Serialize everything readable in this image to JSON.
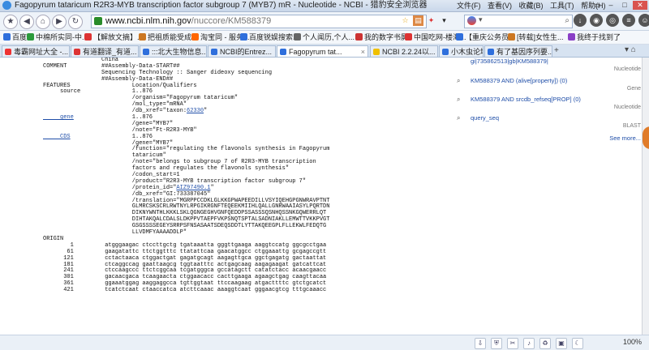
{
  "window": {
    "title": "Fagopyrum tataricum R2R3-MYB transcription factor subgroup 7 (MYB7) mR - Nucleotide - NCBI - 猎豹安全浏览器",
    "menu": [
      "文件(F)",
      "查看(V)",
      "收藏(B)",
      "工具(T)",
      "帮助(H)"
    ]
  },
  "navbar": {
    "url_host": "www.ncbi.nlm.nih.gov",
    "url_path": "/nuccore/KM588379",
    "search_placeholder": "",
    "search_engine": "g"
  },
  "bookmarks": [
    {
      "label": "百度",
      "color": "#2f6fdc"
    },
    {
      "label": "中棉所实同-中...",
      "color": "#2b9a3b"
    },
    {
      "label": "【解放文摘】...",
      "color": "#d33"
    },
    {
      "label": "把祖质能受成...",
      "color": "#c72"
    },
    {
      "label": "淘宝同 - 服务...",
      "color": "#f60"
    },
    {
      "label": "百度锐娱搜索...",
      "color": "#2f6fdc"
    },
    {
      "label": "个人闻历,个人...",
      "color": "#666"
    },
    {
      "label": "我的数字书屏",
      "color": "#c33"
    },
    {
      "label": "中国吃网-楼海...",
      "color": "#d33"
    },
    {
      "label": "【重庆公务员...",
      "color": "#2f6fdc"
    },
    {
      "label": "[转载]女性生...",
      "color": "#c72"
    },
    {
      "label": "我终于找到了",
      "color": "#8a3fc6"
    }
  ],
  "tabs": [
    {
      "label": "毒霸网址大全 -...",
      "active": false,
      "color": "#e33"
    },
    {
      "label": "有道翻译_有道...",
      "color": "#d33",
      "active": false
    },
    {
      "label": ":::北大生物信息...",
      "color": "#2f6fdc",
      "active": false
    },
    {
      "label": "NCBI的Entrez...",
      "color": "#2f6fdc",
      "active": false
    },
    {
      "label": "Fagopyrum tat...",
      "color": "#2f6fdc",
      "active": true
    },
    {
      "label": "NCBI 2.2.24以...",
      "color": "#f0c000",
      "active": false
    },
    {
      "label": "小木虫论坛 - 学...",
      "color": "#2f6fdc",
      "active": false
    },
    {
      "label": "有了基因序列要...",
      "color": "#2f6fdc",
      "active": false
    }
  ],
  "record": {
    "lines": [
      {
        "k": "",
        "v": "China"
      },
      {
        "k": "COMMENT",
        "v": "##Assembly-Data-START##"
      },
      {
        "k": "",
        "v": "Sequencing Technology :: Sanger dideoxy sequencing"
      },
      {
        "k": "",
        "v": "##Assembly-Data-END##"
      },
      {
        "k": "FEATURES",
        "v": "         Location/Qualifiers"
      },
      {
        "k": "     source",
        "v": "         1..876"
      },
      {
        "k": "",
        "v": "         /organism=\"Fagopyrum tataricum\""
      },
      {
        "k": "",
        "v": "         /mol_type=\"mRNA\""
      },
      {
        "k": "",
        "v": "         /db_xref=\"taxon:",
        "link": "62330",
        "tail": "\""
      },
      {
        "k": "     gene",
        "klink": true,
        "v": "         1..876"
      },
      {
        "k": "",
        "v": "         /gene=\"MYB7\""
      },
      {
        "k": "",
        "v": "         /note=\"Ft-R2R3-MYB\""
      },
      {
        "k": "     CDS",
        "klink": true,
        "v": "         1..876"
      },
      {
        "k": "",
        "v": "         /gene=\"MYB7\""
      },
      {
        "k": "",
        "v": "         /function=\"regulating the flavonols synthesis in Fagopyrum"
      },
      {
        "k": "",
        "v": "         tataricum\""
      },
      {
        "k": "",
        "v": "         /note=\"belongs to subgroup 7 of R2R3-MYB transcription"
      },
      {
        "k": "",
        "v": "         factors and regulates the flavonols synthesis\""
      },
      {
        "k": "",
        "v": "         /codon_start=1"
      },
      {
        "k": "",
        "v": "         /product=\"R2R3-MYB transcription factor subgroup 7\""
      },
      {
        "k": "",
        "v": "         /protein_id=\"",
        "link": "AIZ97490.1",
        "tail": "\""
      },
      {
        "k": "",
        "v": "         /db_xref=\"GI:733387045\""
      },
      {
        "k": "",
        "v": "         /translation=\"MGRPPCCDKLGLKKGPWAPEEDILLVSYIQEHGPGNWRAVPTNT"
      },
      {
        "k": "",
        "v": "         GLMRCSKSCRLRWTNYLRPGIKRGNFTEQEEKMIIHLQALLGNRWAAIASYLPQRTDN"
      },
      {
        "k": "",
        "v": "         DIKNYWNTHLKKKLSKLQGNGEGHVGNFQEDDPSSASSSQSNHQSSNKGQWERRLQT"
      },
      {
        "k": "",
        "v": "         DIHTAKQALCDALSLDKPPVTAEPFVKPSNQTSPTALSADNIAKLLEMWTTVKKPVGT"
      },
      {
        "k": "",
        "v": "         GSGSSSSEGEYSRRPSFNSASAATSDEQSDDTLYTTAKQEEGPLFLLEKWLFEDQTG"
      },
      {
        "k": "",
        "v": "         LLVDMFYAAAADDLP\""
      },
      {
        "k": "ORIGIN",
        "v": ""
      },
      {
        "k": "        1",
        "v": " atgggaagac ctccttgctg tgataaatta gggttgaaga aaggtccatg ggcgcctgaa"
      },
      {
        "k": "       61",
        "v": " gaagatattc ttctggtttc ttatattcaa gaacatggcc ctggaaattg gcgagccgtt"
      },
      {
        "k": "      121",
        "v": " cctactaaca ctggactgat gagatgcagt aagagttgca ggctgagatg gactaattat"
      },
      {
        "k": "      181",
        "v": " ctcaggccag gaattaagcg tggtaatttc actgagcaag aagagaagat gatcattcat"
      },
      {
        "k": "      241",
        "v": " ctccaagccc ttctcggcaa tcgatgggca gccatagctt catatctacc acaacgaacc"
      },
      {
        "k": "      301",
        "v": " gacaacgaca tcaagaacta ctggaacacc cacttgaaga agaagctgag caagttacaa"
      },
      {
        "k": "      361",
        "v": " ggaaatggag aaggaggcca tgttggtaat ttccaagaag atgacttttc gtctgcatct"
      },
      {
        "k": "      421",
        "v": " tcatctcaat ctaaccatca atcttcaaac aaaggtcaat gggaacgtcg tttgcaaacc"
      }
    ]
  },
  "sidebar": {
    "items": [
      {
        "text": "gi|735862513|gb|KM588379|",
        "category": "Nucleotide"
      },
      {
        "text": "KM588379 AND (alive[property]) (0)",
        "category": "Gene"
      },
      {
        "text": "KM588379 AND srcdb_refseq[PROP] (0)",
        "category": "Nucleotide"
      },
      {
        "text": "query_seq",
        "category": "BLAST"
      }
    ],
    "see_more": "See more..."
  },
  "statusbar": {
    "zoom": "100%"
  }
}
